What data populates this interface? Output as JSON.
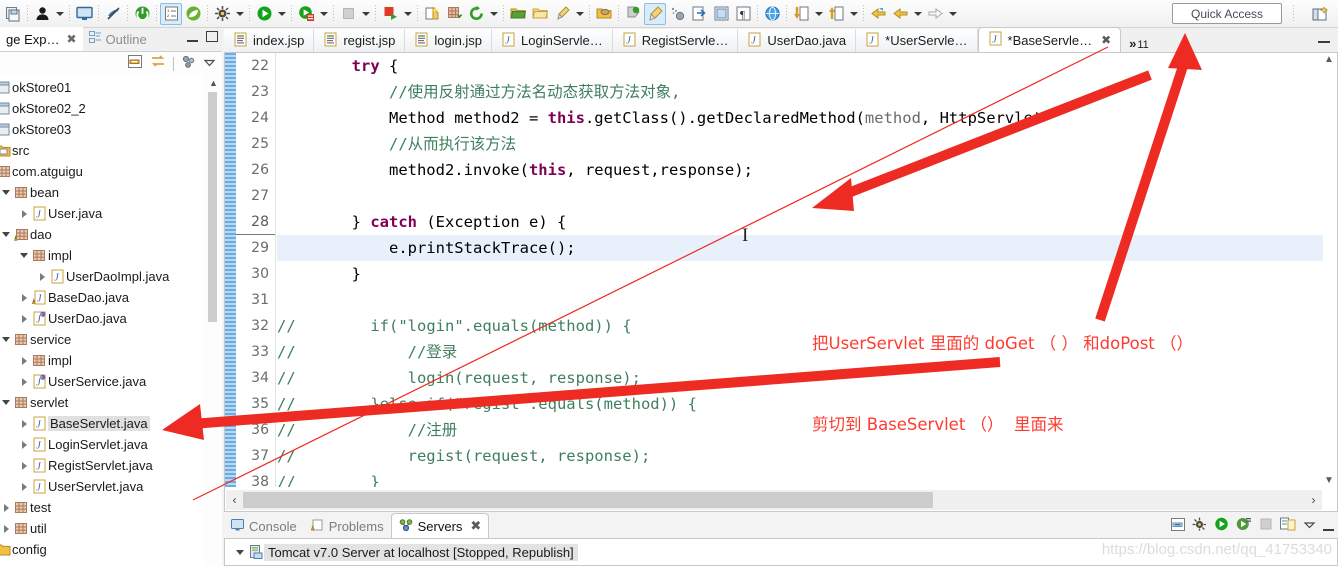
{
  "toolbar": {
    "quick_access_label": "Quick Access",
    "icons": [
      "save-all-icon",
      "user-icon",
      "dropdown-arrow-icon",
      "terminal-icon",
      "no-link-icon",
      "power-green-icon",
      "outline-sel-icon",
      "leaf-green-icon",
      "debug-bug-icon",
      "dropdown-arrow-icon",
      "run-green-icon",
      "dropdown-arrow-icon",
      "run-server-icon",
      "dropdown-arrow-icon",
      "stop-grey-icon",
      "dropdown-arrow-icon",
      "publish-red-icon",
      "dropdown-arrow-icon",
      "new-wizard-icon",
      "new-grid-icon",
      "refresh-green-icon",
      "dropdown-arrow-icon",
      "open-folder-icon",
      "open-folder2-icon",
      "brush-icon",
      "dropdown-arrow-icon",
      "package-open-icon",
      "tag-green-icon",
      "paintbrush-sel-icon",
      "spray-icon",
      "import-icon",
      "book-icon",
      "pilcrow-icon",
      "globe-icon",
      "download-icon",
      "dropdown-arrow-icon",
      "upload-icon",
      "dropdown-arrow-icon",
      "back-yellow-icon",
      "back-yellow2-icon",
      "dropdown-arrow-icon",
      "forward-grey-icon",
      "dropdown-arrow-icon"
    ],
    "perspective_icon": "open-perspective-icon"
  },
  "left_panel": {
    "tabs": [
      {
        "label": "ge Exp…",
        "icon": "package-explorer-icon",
        "active": true,
        "closable": true
      },
      {
        "label": "Outline",
        "icon": "outline-icon",
        "active": false,
        "closable": false
      }
    ],
    "view_tools": [
      "collapse-all-icon",
      "link-editor-icon",
      "filters-icon",
      "view-menu-icon"
    ],
    "window_buttons": [
      "minimize-icon",
      "maximize-icon"
    ],
    "tree": [
      {
        "label": "okStore01",
        "indent": 0,
        "twisty": "none",
        "icon": "project-icon",
        "selected": false
      },
      {
        "label": "okStore02_2",
        "indent": 0,
        "twisty": "none",
        "icon": "project-icon",
        "selected": false
      },
      {
        "label": "okStore03",
        "indent": 0,
        "twisty": "none",
        "icon": "project-icon",
        "selected": false
      },
      {
        "label": "src",
        "indent": 0,
        "twisty": "none",
        "icon": "source-folder-icon",
        "selected": false
      },
      {
        "label": "com.atguigu",
        "indent": 0,
        "twisty": "none",
        "icon": "package-warn-icon",
        "selected": false
      },
      {
        "label": "bean",
        "indent": 1,
        "twisty": "expanded",
        "icon": "package-icon",
        "selected": false
      },
      {
        "label": "User.java",
        "indent": 2,
        "twisty": "collapsed",
        "icon": "java-file-icon",
        "selected": false
      },
      {
        "label": "dao",
        "indent": 1,
        "twisty": "expanded",
        "icon": "package-warn-icon",
        "selected": false
      },
      {
        "label": "impl",
        "indent": 2,
        "twisty": "expanded",
        "icon": "package-icon",
        "selected": false
      },
      {
        "label": "UserDaoImpl.java",
        "indent": 3,
        "twisty": "collapsed",
        "icon": "java-file-icon",
        "selected": false
      },
      {
        "label": "BaseDao.java",
        "indent": 2,
        "twisty": "collapsed",
        "icon": "java-warn-icon",
        "selected": false
      },
      {
        "label": "UserDao.java",
        "indent": 2,
        "twisty": "collapsed",
        "icon": "java-interface-icon",
        "selected": false
      },
      {
        "label": "service",
        "indent": 1,
        "twisty": "expanded",
        "icon": "package-icon",
        "selected": false
      },
      {
        "label": "impl",
        "indent": 2,
        "twisty": "collapsed",
        "icon": "package-icon",
        "selected": false
      },
      {
        "label": "UserService.java",
        "indent": 2,
        "twisty": "collapsed",
        "icon": "java-interface-icon",
        "selected": false
      },
      {
        "label": "servlet",
        "indent": 1,
        "twisty": "expanded",
        "icon": "package-icon",
        "selected": false
      },
      {
        "label": "BaseServlet.java",
        "indent": 2,
        "twisty": "collapsed",
        "icon": "java-file-icon",
        "selected": true
      },
      {
        "label": "LoginServlet.java",
        "indent": 2,
        "twisty": "collapsed",
        "icon": "java-file-icon",
        "selected": false
      },
      {
        "label": "RegistServlet.java",
        "indent": 2,
        "twisty": "collapsed",
        "icon": "java-file-icon",
        "selected": false
      },
      {
        "label": "UserServlet.java",
        "indent": 2,
        "twisty": "collapsed",
        "icon": "java-file-icon",
        "selected": false
      },
      {
        "label": "test",
        "indent": 1,
        "twisty": "collapsed",
        "icon": "package-icon",
        "selected": false
      },
      {
        "label": "util",
        "indent": 1,
        "twisty": "collapsed",
        "icon": "package-icon",
        "selected": false
      },
      {
        "label": "config",
        "indent": 0,
        "twisty": "none",
        "icon": "folder-icon",
        "selected": false
      }
    ]
  },
  "editor": {
    "tabs": [
      {
        "label": "index.jsp",
        "icon": "jsp-file-icon",
        "active": false,
        "dirty": false
      },
      {
        "label": "regist.jsp",
        "icon": "jsp-file-icon",
        "active": false,
        "dirty": false
      },
      {
        "label": "login.jsp",
        "icon": "jsp-file-icon",
        "active": false,
        "dirty": false
      },
      {
        "label": "LoginServle…",
        "icon": "java-file-icon",
        "active": false,
        "dirty": false
      },
      {
        "label": "RegistServle…",
        "icon": "java-file-icon",
        "active": false,
        "dirty": false
      },
      {
        "label": "UserDao.java",
        "icon": "java-file-icon",
        "active": false,
        "dirty": false
      },
      {
        "label": "*UserServle…",
        "icon": "java-file-icon",
        "active": false,
        "dirty": true
      },
      {
        "label": "*BaseServle…",
        "icon": "java-file-icon",
        "active": true,
        "dirty": true
      }
    ],
    "overflow_chevron": "»",
    "overflow_count": "11",
    "close_glyph": "✖",
    "minimize_icon": "minimize-icon",
    "current_line": 29,
    "first_line": 22,
    "lines": [
      {
        "n": 22,
        "tokens": [
          {
            "t": "        ",
            "c": "plain"
          },
          {
            "t": "try",
            "c": "kw"
          },
          {
            "t": " {",
            "c": "plain"
          }
        ]
      },
      {
        "n": 23,
        "tokens": [
          {
            "t": "            //使用反射通过方法名动态获取方法对象,",
            "c": "cmt"
          }
        ]
      },
      {
        "n": 24,
        "tokens": [
          {
            "t": "            Method method2 = ",
            "c": "plain"
          },
          {
            "t": "this",
            "c": "kw"
          },
          {
            "t": ".getClass().getDeclaredMethod(",
            "c": "plain"
          },
          {
            "t": "method",
            "c": "prm"
          },
          {
            "t": ", HttpServlet",
            "c": "plain"
          }
        ]
      },
      {
        "n": 25,
        "tokens": [
          {
            "t": "            //从而执行该方法",
            "c": "cmt"
          }
        ]
      },
      {
        "n": 26,
        "tokens": [
          {
            "t": "            method2.invoke(",
            "c": "plain"
          },
          {
            "t": "this",
            "c": "kw"
          },
          {
            "t": ", request,response);",
            "c": "plain"
          }
        ]
      },
      {
        "n": 27,
        "tokens": [
          {
            "t": "",
            "c": "plain"
          }
        ]
      },
      {
        "n": 28,
        "tokens": [
          {
            "t": "        } ",
            "c": "plain"
          },
          {
            "t": "catch",
            "c": "kw"
          },
          {
            "t": " (Exception e) {",
            "c": "plain"
          }
        ]
      },
      {
        "n": 29,
        "tokens": [
          {
            "t": "            e.printStackTrace();",
            "c": "plain"
          }
        ]
      },
      {
        "n": 30,
        "tokens": [
          {
            "t": "        }",
            "c": "plain"
          }
        ]
      },
      {
        "n": 31,
        "tokens": [
          {
            "t": "",
            "c": "plain"
          }
        ]
      },
      {
        "n": 32,
        "tokens": [
          {
            "t": "//        if(",
            "c": "cmt"
          },
          {
            "t": "\"login\"",
            "c": "cmt"
          },
          {
            "t": ".equals(method)) {",
            "c": "cmt"
          }
        ]
      },
      {
        "n": 33,
        "tokens": [
          {
            "t": "//            //登录",
            "c": "cmt"
          }
        ]
      },
      {
        "n": 34,
        "tokens": [
          {
            "t": "//            login(request, response);",
            "c": "cmt"
          }
        ]
      },
      {
        "n": 35,
        "tokens": [
          {
            "t": "//        }else if(\"regist\".equals(method)) {",
            "c": "cmt"
          }
        ]
      },
      {
        "n": 36,
        "tokens": [
          {
            "t": "//            //注册",
            "c": "cmt"
          }
        ]
      },
      {
        "n": 37,
        "tokens": [
          {
            "t": "//            regist(request, response);",
            "c": "cmt"
          }
        ]
      },
      {
        "n": 38,
        "tokens": [
          {
            "t": "//        }",
            "c": "cmt"
          }
        ]
      }
    ],
    "hscroll_left_glyph": "‹",
    "hscroll_right_glyph": "›"
  },
  "bottom_panel": {
    "tabs": [
      {
        "label": "Console",
        "icon": "console-icon",
        "active": false,
        "closable": false
      },
      {
        "label": "Problems",
        "icon": "problems-icon",
        "active": false,
        "closable": false
      },
      {
        "label": "Servers",
        "icon": "servers-icon",
        "active": true,
        "closable": true
      }
    ],
    "close_glyph": "✖",
    "tools": [
      "collapse-all-icon",
      "debug-server-icon",
      "start-server-icon",
      "profile-server-icon",
      "stop-server-icon",
      "publish-icon",
      "view-menu-icon",
      "minimize-icon"
    ],
    "server_row": {
      "twisty": "expanded",
      "icon": "server-icon",
      "label": "Tomcat v7.0 Server at localhost  [Stopped, Republish]"
    }
  },
  "annotations": {
    "note_line1": "把UserServlet 里面的 doGet （ ） 和doPost （）",
    "note_line2": "剪切到 BaseServlet （）  里面来",
    "note_color": "#ff3b30",
    "arrow_color": "#ee2b22"
  },
  "watermark": "https://blog.csdn.net/qq_41753340"
}
